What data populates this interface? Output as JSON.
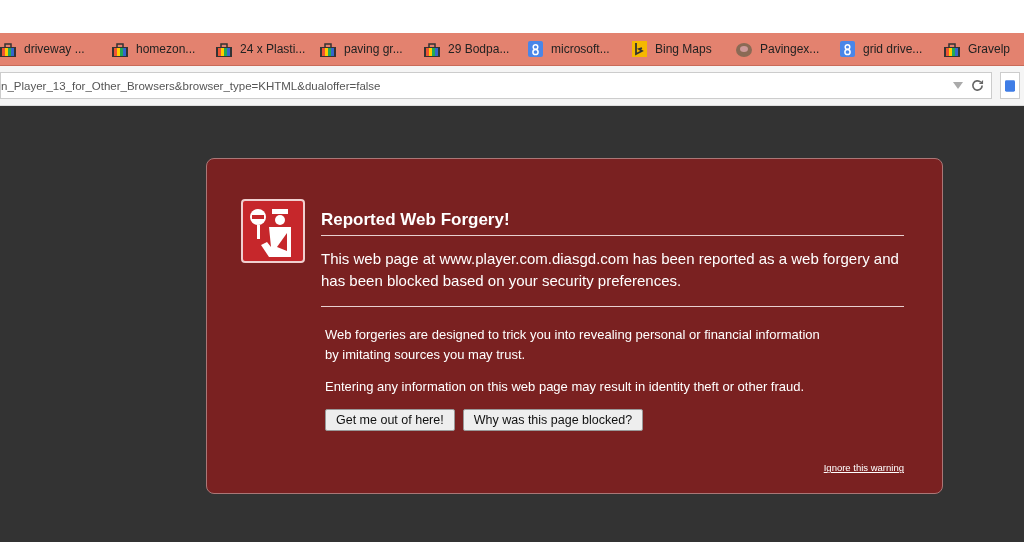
{
  "bookmarks": [
    {
      "label": "driveway ...",
      "kind": "bag"
    },
    {
      "label": "homezon...",
      "kind": "bag"
    },
    {
      "label": "24 x Plasti...",
      "kind": "bag"
    },
    {
      "label": "paving gr...",
      "kind": "bag"
    },
    {
      "label": "29 Bodpa...",
      "kind": "bag"
    },
    {
      "label": "microsoft...",
      "kind": "google"
    },
    {
      "label": "Bing Maps",
      "kind": "bing"
    },
    {
      "label": "Pavingex...",
      "kind": "photo"
    },
    {
      "label": "grid drive...",
      "kind": "google"
    },
    {
      "label": "Gravelp",
      "kind": "bag"
    }
  ],
  "address_bar": {
    "value": "n_Player_13_for_Other_Browsers&browser_type=KHTML&dualoffer=false"
  },
  "warning": {
    "title": "Reported Web Forgery!",
    "message": "This web page at www.player.com.diasgd.com has been reported as a web forgery and has been blocked based on your security preferences.",
    "details": [
      "Web forgeries are designed to trick you into revealing personal or financial information by imitating sources you may trust.",
      "Entering any information on this web page may result in identity theft or other fraud."
    ],
    "buttons": [
      "Get me out of here!",
      "Why was this page blocked?"
    ],
    "ignore_link": "Ignore this warning"
  }
}
